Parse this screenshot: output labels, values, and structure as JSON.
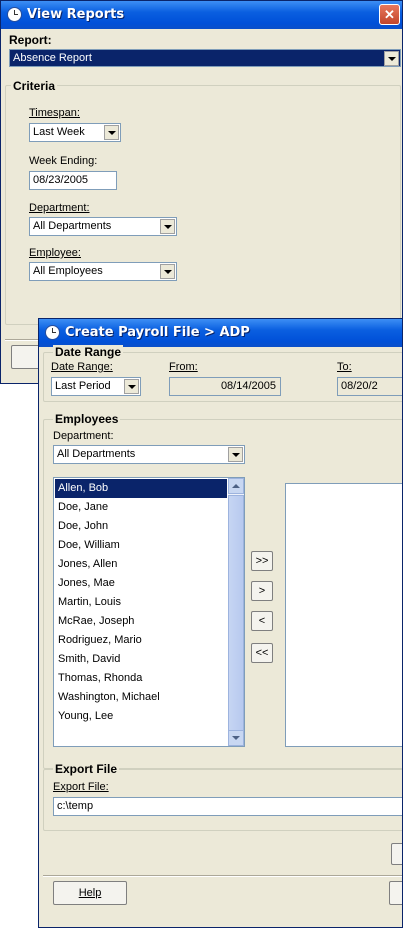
{
  "view_reports": {
    "title": "View Reports",
    "close_glyph": "✕",
    "report_label": "Report:",
    "report_value": "Absence Report",
    "criteria_label": "Criteria",
    "timespan_label": "Timespan:",
    "timespan_value": "Last Week",
    "week_ending_label": "Week Ending:",
    "week_ending_value": "08/23/2005",
    "department_label": "Department:",
    "department_value": "All Departments",
    "employee_label": "Employee:",
    "employee_value": "All Employees"
  },
  "payroll": {
    "title": "Create Payroll File > ADP",
    "date_range_group": "Date Range",
    "date_range_label": "Date Range:",
    "date_range_value": "Last Period",
    "from_label": "From:",
    "from_value": "08/14/2005",
    "to_label": "To:",
    "to_value": "08/20/2",
    "employees_group": "Employees",
    "department_label": "Department:",
    "department_value": "All Departments",
    "employees": [
      "Allen, Bob",
      "Doe, Jane",
      "Doe, John",
      "Doe, William",
      "Jones, Allen",
      "Jones, Mae",
      "Martin, Louis",
      "McRae, Joseph",
      "Rodriguez, Mario",
      "Smith, David",
      "Thomas, Rhonda",
      "Washington, Michael",
      "Young, Lee"
    ],
    "add_all_label": ">>",
    "add_label": ">",
    "remove_label": "<",
    "remove_all_label": "<<",
    "export_group": "Export File",
    "export_label": "Export File:",
    "export_value": "c:\\temp",
    "help_label": "Help"
  }
}
